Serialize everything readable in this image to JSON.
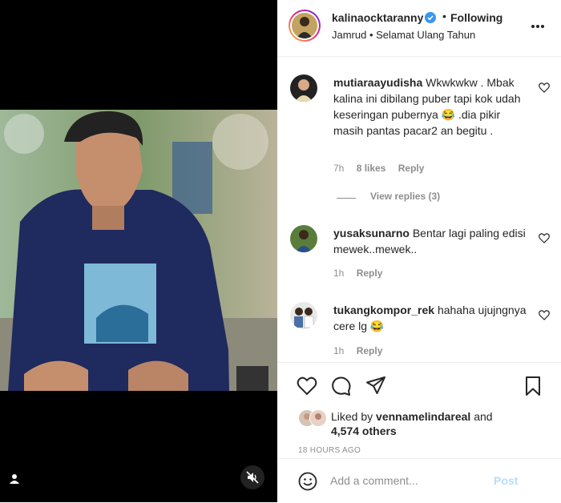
{
  "header": {
    "username": "kalinaocktaranny",
    "separator": "•",
    "follow_status": "Following",
    "subtitle": "Jamrud • Selamat Ulang Tahun"
  },
  "comments": [
    {
      "username": "mutiaraayudisha",
      "text": "Wkwkwkw . Mbak kalina ini dibilang puber tapi kok udah keseringan pubernya 😂 .dia pikir masih pantas pacar2 an begitu .",
      "time": "7h",
      "likes": "8 likes",
      "reply": "Reply",
      "view_replies": "View replies (3)"
    },
    {
      "username": "yusaksunarno",
      "text": "Bentar lagi paling edisi mewek..mewek..",
      "time": "1h",
      "reply": "Reply"
    },
    {
      "username": "tukangkompor_rek",
      "text": "hahaha ujujngnya cere lg 😂",
      "time": "1h",
      "reply": "Reply"
    }
  ],
  "likes": {
    "prefix": "Liked by",
    "user": "vennamelindareal",
    "and": "and",
    "others": "4,574 others"
  },
  "time_ago": "18 HOURS AGO",
  "add_comment": {
    "placeholder": "Add a comment...",
    "post_label": "Post"
  },
  "colors": {
    "verified": "#3897f0",
    "post_disabled": "#b2dffc",
    "secondary_text": "#8e8e8e"
  },
  "icons": [
    "user-tag-icon",
    "mute-icon",
    "verified-icon",
    "more-icon",
    "heart-icon",
    "comment-icon",
    "share-icon",
    "bookmark-icon",
    "emoji-icon"
  ]
}
